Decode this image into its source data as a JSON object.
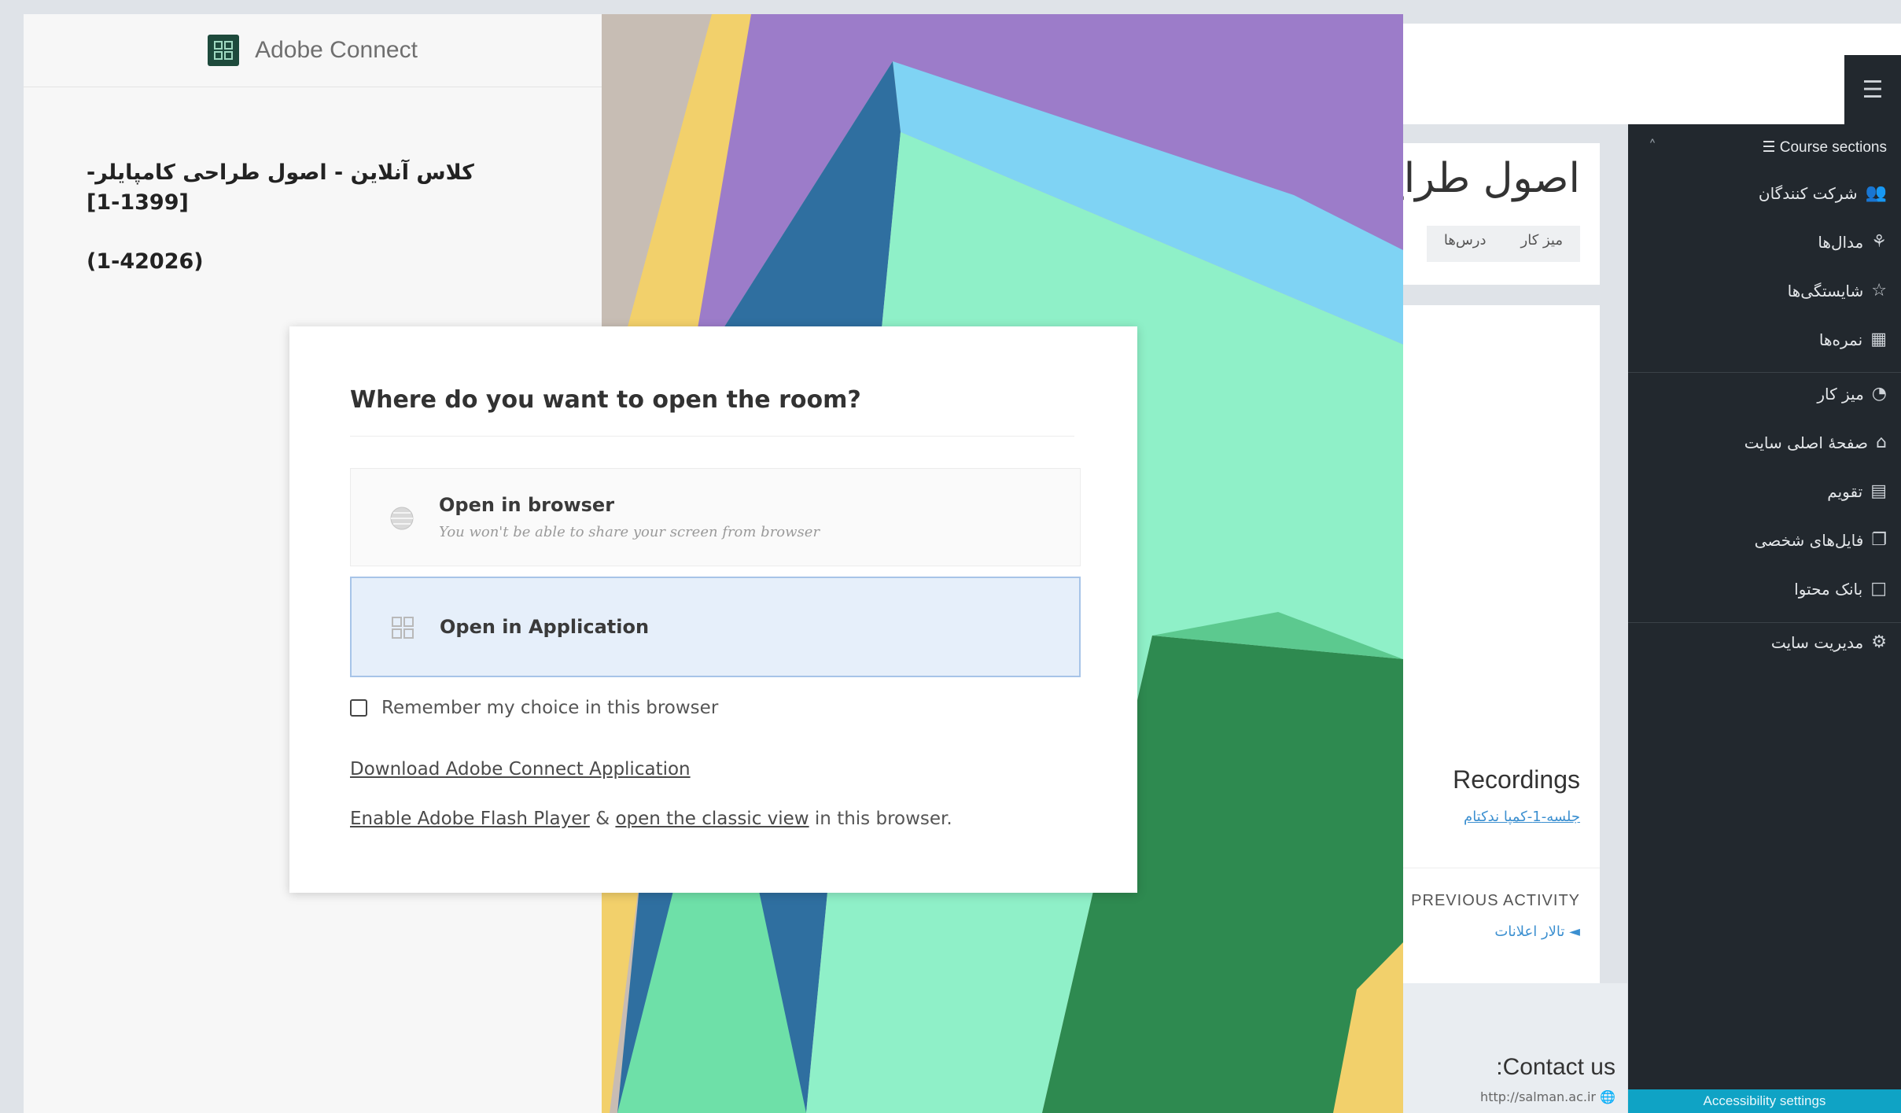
{
  "adobe_connect": {
    "app_name": "Adobe Connect",
    "room_title_fa": "کلاس آنلاین - اصول طراحی کامپایلر- [1399-1]",
    "room_title_code": "(1-42026)"
  },
  "dialog": {
    "title": "Where do you want to open the room?",
    "option_browser_label": "Open in browser",
    "option_browser_hint": "You won't be able to share your screen from browser",
    "option_app_label": "Open in Application",
    "remember_label": "Remember my choice in this browser",
    "download_link": "Download Adobe Connect Application",
    "flash_link": "Enable Adobe Flash Player",
    "flash_joiner": "&",
    "classic_link": "open the classic view",
    "flash_suffix": "in this browser."
  },
  "moodle": {
    "course_title": "اصول طراح",
    "tabs": [
      "میز کار",
      "درس‌ها"
    ],
    "recordings_title": "Recordings",
    "recording_link": "جلسه-1-کمپا ندکتام",
    "previous_activity_label": "PREVIOUS ACTIVITY",
    "previous_activity_link": "◄ تالار اعلانات",
    "contact_title": ":Contact us",
    "contact_url": "http://salman.ac.ir",
    "menu_icon": "☰",
    "sidebar": {
      "sections_label": "Course sections",
      "items": [
        {
          "label": "شرکت کنندگان",
          "icon": "participants-icon"
        },
        {
          "label": "مدال‌ها",
          "icon": "badges-icon"
        },
        {
          "label": "شایستگی‌ها",
          "icon": "competencies-icon"
        },
        {
          "label": "نمره‌ها",
          "icon": "grades-icon"
        },
        {
          "label": "میز کار",
          "icon": "dashboard-icon"
        },
        {
          "label": "صفحهٔ اصلی سایت",
          "icon": "home-icon"
        },
        {
          "label": "تقویم",
          "icon": "calendar-icon"
        },
        {
          "label": "فایل‌های شخصی",
          "icon": "files-icon"
        },
        {
          "label": "بانک محتوا",
          "icon": "content-bank-icon"
        },
        {
          "label": "مدیریت سایت",
          "icon": "settings-icon"
        }
      ],
      "accessibility_label": "Accessibility settings"
    }
  },
  "colors": {
    "sidebar_bg": "#22282e",
    "dialog_selected_bg": "#e6effa",
    "accent_link": "#3b8fd0",
    "access_button": "#0fa3c5"
  }
}
